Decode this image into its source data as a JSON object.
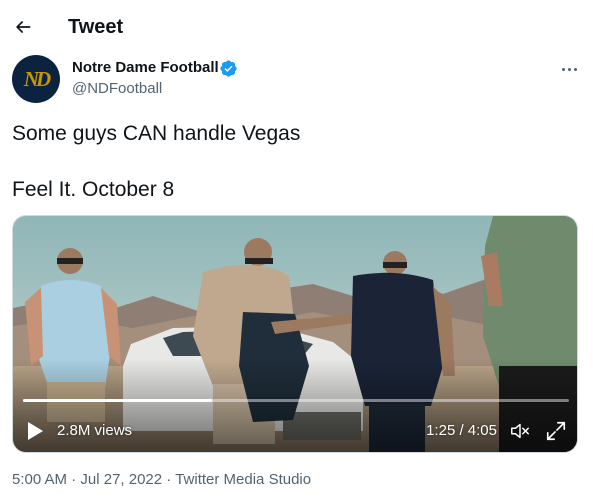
{
  "header": {
    "title": "Tweet",
    "back_icon": "arrow-left-icon"
  },
  "author": {
    "name": "Notre Dame Football",
    "handle": "@NDFootball",
    "verified": true,
    "avatar_text": "ND",
    "avatar_bg": "#0c2340",
    "avatar_fg": "#c99700",
    "verified_color": "#1d9bf0"
  },
  "tweet": {
    "line1": "Some guys CAN handle Vegas",
    "line2": "Feel It. October 8"
  },
  "video": {
    "views": "2.8M views",
    "time": "1:25 / 4:05",
    "progress": 0.347,
    "play_icon": "play-icon",
    "volume_icon": "speaker-muted-icon",
    "fullscreen_icon": "fullscreen-icon"
  },
  "meta": {
    "time": "5:00 AM",
    "separator": "·",
    "date": "Jul 27, 2022",
    "source": "Twitter Media Studio"
  },
  "colors": {
    "text_primary": "#0f1419",
    "text_secondary": "#536471",
    "accent": "#1d9bf0"
  }
}
